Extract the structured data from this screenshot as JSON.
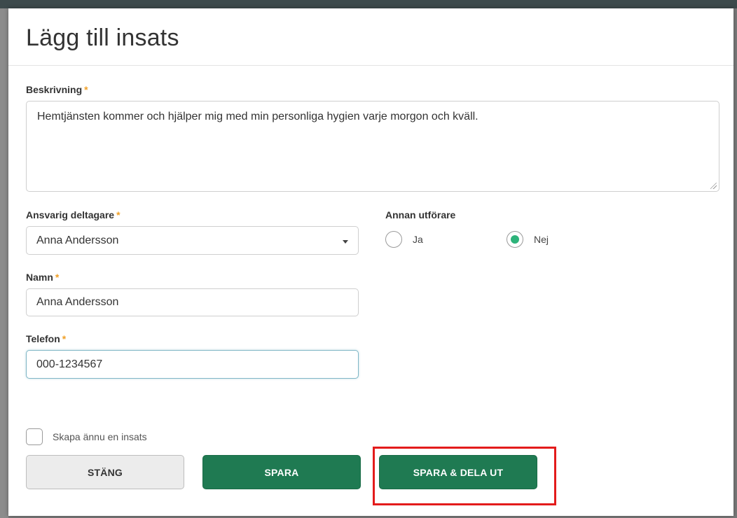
{
  "modal": {
    "title": "Lägg till insats"
  },
  "form": {
    "required_marker": "*",
    "beskrivning": {
      "label": "Beskrivning",
      "value": "Hemtjänsten kommer och hjälper mig med min personliga hygien varje morgon och kväll."
    },
    "ansvarig_deltagare": {
      "label": "Ansvarig deltagare",
      "selected": "Anna Andersson"
    },
    "annan_utforare": {
      "label": "Annan utförare",
      "options": [
        {
          "label": "Ja",
          "checked": false
        },
        {
          "label": "Nej",
          "checked": true
        }
      ]
    },
    "namn": {
      "label": "Namn",
      "value": "Anna Andersson"
    },
    "telefon": {
      "label": "Telefon",
      "value": "000-1234567"
    },
    "skapa_annu": {
      "label": "Skapa ännu en insats",
      "checked": false
    }
  },
  "buttons": {
    "close": "STÄNG",
    "save": "SPARA",
    "save_share": "SPARA & DELA UT"
  },
  "colors": {
    "primary": "#1f7a52",
    "radio_checked": "#2db37a",
    "required": "#f0a028",
    "highlight": "#e31b1b"
  }
}
